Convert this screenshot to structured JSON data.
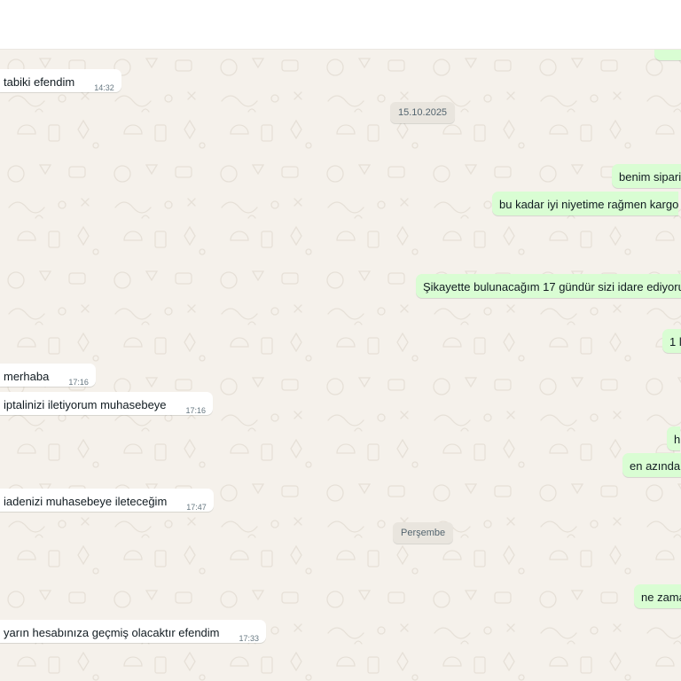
{
  "messages": [
    {
      "text": "tabiki efendim",
      "time": "14:32"
    },
    {
      "text": "benim sipari"
    },
    {
      "text": "bu kadar iyi niyetime rağmen kargo"
    },
    {
      "text": "Şikayette bulunacağım 17 gündür sizi idare ediyoru"
    },
    {
      "text": "1 l"
    },
    {
      "text": "merhaba",
      "time": "17:16"
    },
    {
      "text": "iptalinizi iletiyorum muhasebeye",
      "time": "17:16"
    },
    {
      "text": "h"
    },
    {
      "text": "en azından"
    },
    {
      "text": "iadenizi muhasebeye ileteceğim",
      "time": "17:47"
    },
    {
      "text": "ne zama"
    },
    {
      "text": "yarın hesabınıza geçmiş olacaktır efendim",
      "time": "17:33"
    }
  ],
  "date_separators": [
    "15.10.2025",
    "Perşembe"
  ],
  "colors": {
    "chat_bg": "#f5f1eb",
    "outgoing_bubble": "#d9fdd3",
    "incoming_bubble": "#ffffff",
    "date_pill": "#e9e5de"
  }
}
